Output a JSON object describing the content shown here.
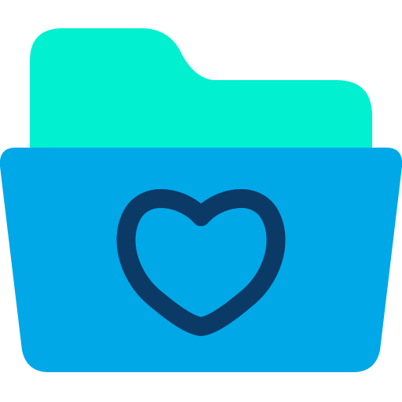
{
  "icon": {
    "name": "favorite-folder-icon",
    "parts": {
      "folder_back": "folder-back-icon",
      "folder_front": "folder-front-icon",
      "heart": "heart-icon"
    }
  },
  "colors": {
    "folder_back": "#00F0D0",
    "folder_front": "#00A8E8",
    "heart_stroke": "#0B3A66"
  }
}
